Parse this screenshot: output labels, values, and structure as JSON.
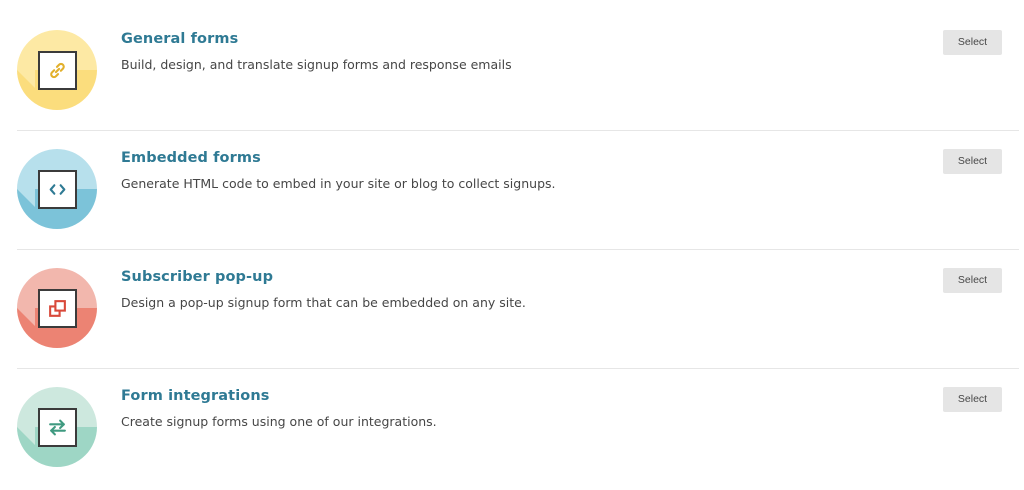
{
  "select_label": "Select",
  "options": [
    {
      "title": "General forms",
      "description": "Build, design, and translate signup forms and response emails",
      "icon": "link-icon",
      "colors": {
        "top": "#fde9a4",
        "bottom": "#fbdd7d",
        "icon": "#e2b02c"
      }
    },
    {
      "title": "Embedded forms",
      "description": "Generate HTML code to embed in your site or blog to collect signups.",
      "icon": "code-icon",
      "colors": {
        "top": "#b7e0ec",
        "bottom": "#7cc3d9",
        "icon": "#2f7a94"
      }
    },
    {
      "title": "Subscriber pop-up",
      "description": "Design a pop-up signup form that can be embedded on any site.",
      "icon": "popup-windows-icon",
      "colors": {
        "top": "#f2b7ad",
        "bottom": "#ec8373",
        "icon": "#d9493a"
      }
    },
    {
      "title": "Form integrations",
      "description": "Create signup forms using one of our integrations.",
      "icon": "arrows-swap-icon",
      "colors": {
        "top": "#cde8de",
        "bottom": "#9ed6c5",
        "icon": "#3f9a80"
      }
    }
  ]
}
